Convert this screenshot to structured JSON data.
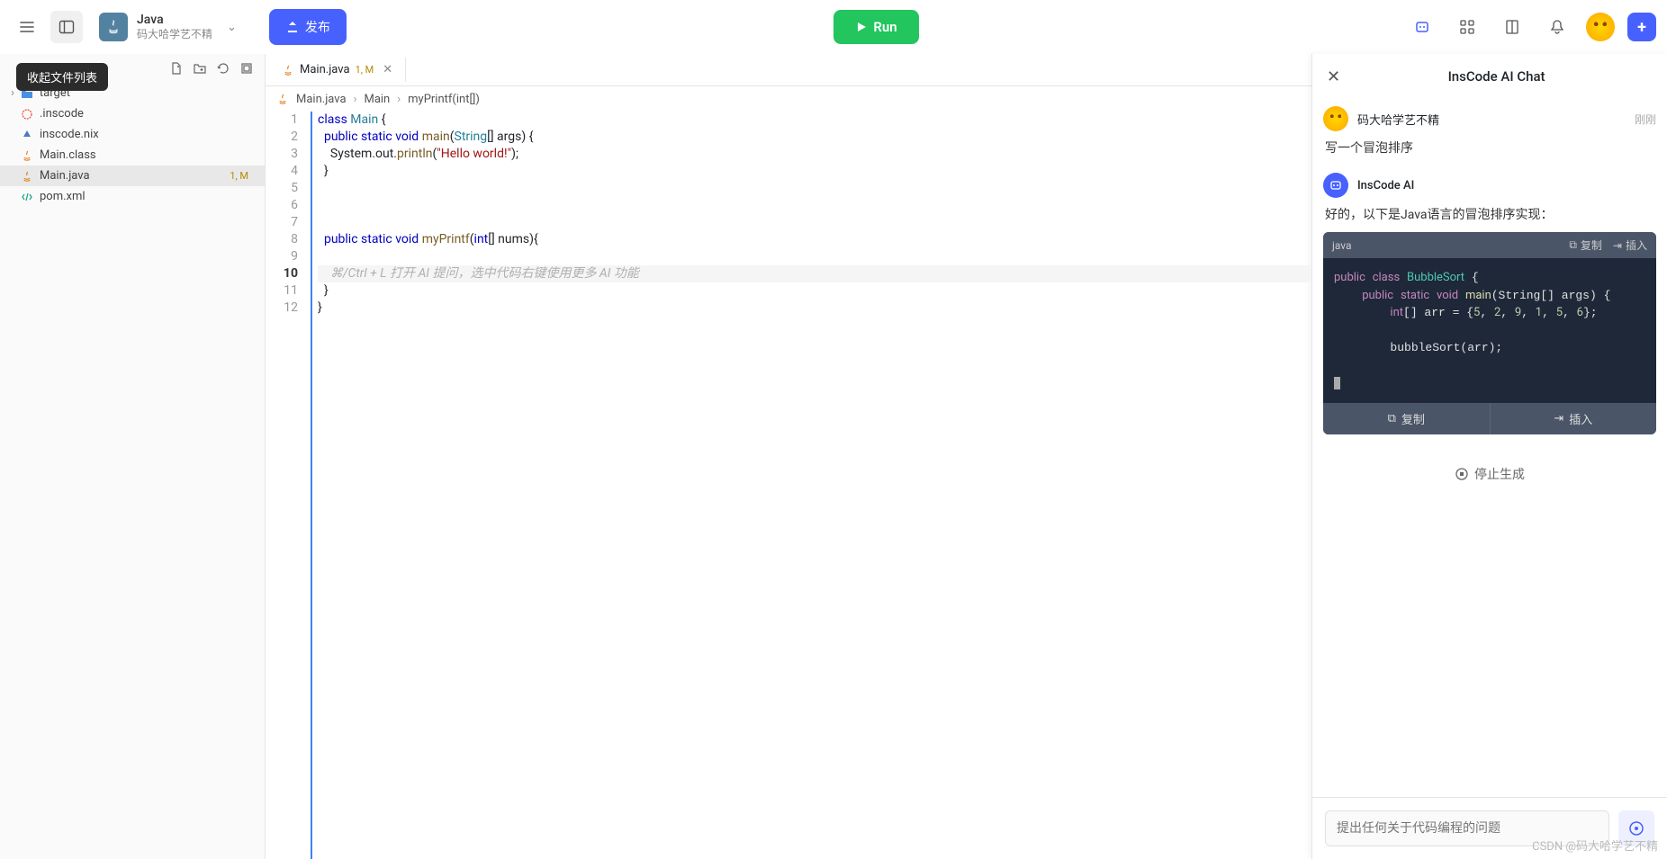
{
  "topbar": {
    "project_name": "Java",
    "project_sub": "码大哈学艺不精",
    "publish_label": "发布",
    "run_label": "Run"
  },
  "tooltip": "收起文件列表",
  "files": [
    {
      "name": "target",
      "icon": "folder",
      "status": ""
    },
    {
      "name": ".inscode",
      "icon": "config",
      "status": ""
    },
    {
      "name": "inscode.nix",
      "icon": "nix",
      "status": ""
    },
    {
      "name": "Main.class",
      "icon": "java",
      "status": ""
    },
    {
      "name": "Main.java",
      "icon": "java",
      "status": "1, M",
      "selected": true
    },
    {
      "name": "pom.xml",
      "icon": "xml",
      "status": ""
    }
  ],
  "tab": {
    "name": "Main.java",
    "status": "1, M"
  },
  "breadcrumb": [
    "Main.java",
    "Main",
    "myPrintf(int[])"
  ],
  "editor": {
    "line_count": 12,
    "current_line": 10,
    "hint": "⌘/Ctrl + L 打开 AI 提问，选中代码右键使用更多 AI 功能"
  },
  "chat": {
    "title": "InsCode AI Chat",
    "user_name": "码大哈学艺不精",
    "user_time": "刚刚",
    "user_msg": "写一个冒泡排序",
    "ai_name": "InsCode AI",
    "ai_msg": "好的，以下是Java语言的冒泡排序实现：",
    "code_lang": "java",
    "copy_label": "复制",
    "insert_label": "插入",
    "foot_copy": "复制",
    "foot_insert": "插入",
    "stop_label": "停止生成",
    "input_placeholder": "提出任何关于代码编程的问题"
  },
  "watermark": "CSDN @码大哈学艺不精"
}
